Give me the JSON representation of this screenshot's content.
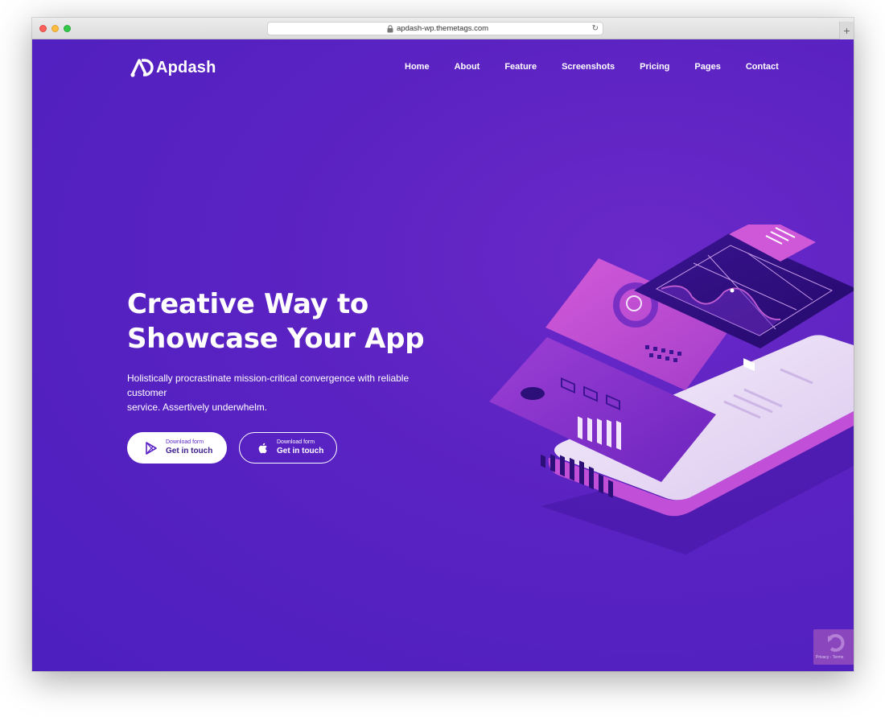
{
  "browser": {
    "url": "apdash-wp.themetags.com",
    "new_tab_label": "+"
  },
  "site": {
    "logo_text": "Apdash",
    "nav": [
      "Home",
      "About",
      "Feature",
      "Screenshots",
      "Pricing",
      "Pages",
      "Contact"
    ]
  },
  "hero": {
    "title_line1": "Creative Way to",
    "title_line2": "Showcase Your App",
    "subtitle_line1": "Holistically procrastinate mission-critical convergence with reliable customer",
    "subtitle_line2": "service. Assertively underwhelm.",
    "buttons": [
      {
        "small": "Download form",
        "big": "Get in touch",
        "icon": "google-play-icon"
      },
      {
        "small": "Download form",
        "big": "Get in touch",
        "icon": "apple-icon"
      }
    ]
  },
  "recaptcha": {
    "text": "Privacy - Terms"
  },
  "colors": {
    "background": "#5a22c4",
    "accent_pink": "#c44bd6",
    "dark_purple": "#2d0f7a",
    "white": "#ffffff"
  }
}
